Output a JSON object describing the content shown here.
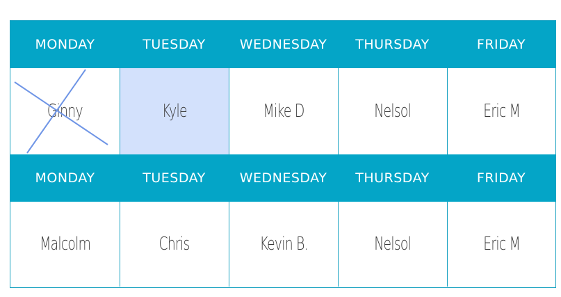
{
  "weeks": [
    {
      "days": [
        "MONDAY",
        "TUESDAY",
        "WEDNESDAY",
        "THURSDAY",
        "FRIDAY"
      ],
      "names": [
        "Ginny",
        "Kyle",
        "Mike D",
        "Nelsol",
        "Eric M"
      ],
      "crossed_out": [
        true,
        false,
        false,
        false,
        false
      ],
      "highlighted": [
        false,
        true,
        false,
        false,
        false
      ]
    },
    {
      "days": [
        "MONDAY",
        "TUESDAY",
        "WEDNESDAY",
        "THURSDAY",
        "FRIDAY"
      ],
      "names": [
        "Malcolm",
        "Chris",
        "Kevin B.",
        "Nelsol",
        "Eric M"
      ],
      "crossed_out": [
        false,
        false,
        false,
        false,
        false
      ],
      "highlighted": [
        false,
        false,
        false,
        false,
        false
      ]
    }
  ],
  "colors": {
    "header_bg": "#04a5c7",
    "header_text": "#ffffff",
    "highlight": "#d3e1fc",
    "strike": "#6f95e6",
    "border": "#1ba3c2"
  }
}
